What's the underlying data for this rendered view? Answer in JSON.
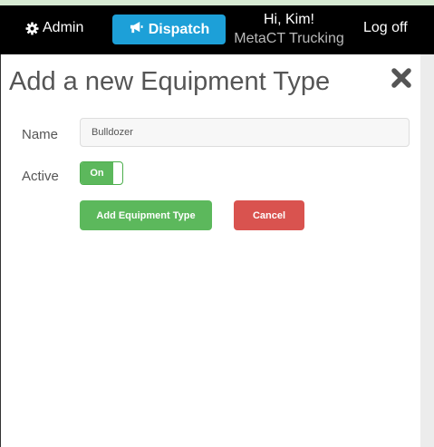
{
  "colors": {
    "navbar_bg": "#000000",
    "dispatch_bg": "#1da0d8",
    "success": "#5cb85c",
    "danger": "#d9534f",
    "company_text": "#b9b9b9"
  },
  "navbar": {
    "admin": {
      "icon": "gear-icon",
      "label": "Admin"
    },
    "dispatch": {
      "icon": "megaphone-icon",
      "label": "Dispatch"
    },
    "greeting": "Hi, Kim!",
    "company": "MetaCT Trucking",
    "logoff": "Log off"
  },
  "dialog": {
    "title": "Add a new Equipment Type",
    "close_icon": "close-icon",
    "name_label": "Name",
    "name_value": "Bulldozer",
    "active_label": "Active",
    "active_toggle": {
      "state": "On",
      "checked": true
    },
    "add_button": "Add Equipment Type",
    "cancel_button": "Cancel"
  }
}
